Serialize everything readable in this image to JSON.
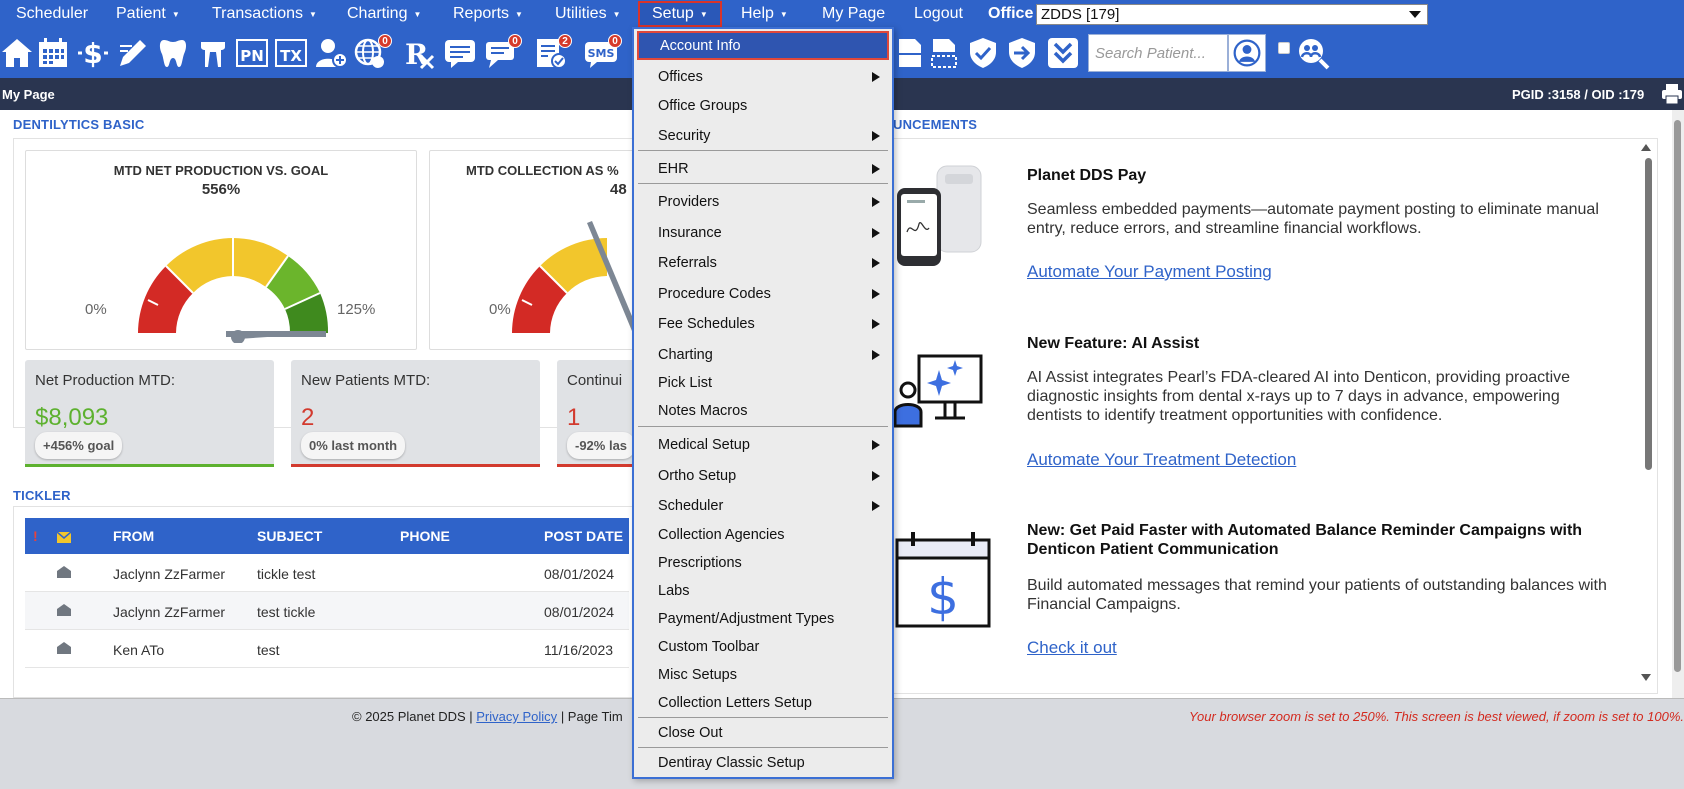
{
  "menubar": {
    "items": [
      "Scheduler",
      "Patient",
      "Transactions",
      "Charting",
      "Reports",
      "Utilities",
      "Setup",
      "Help",
      "My Page",
      "Logout"
    ],
    "office_label": "Office",
    "office_value": "ZDDS [179]"
  },
  "toolbar": {
    "icons": [
      "home-icon",
      "calendar-icon",
      "dollar-icon",
      "pencil-icon",
      "tooth-icon",
      "tooth-roots-icon",
      "pn-icon",
      "tx-icon",
      "add-user-icon",
      "globe-icon",
      "rx-icon",
      "message-icon",
      "chat-icon",
      "checklist-icon",
      "sms-icon",
      "document-icon",
      "dashed-document-icon",
      "shield-check-icon",
      "shield-arrow-icon",
      "double-chevron-down-icon",
      "user-search-icon",
      "group-search-icon"
    ],
    "labels": {
      "pn": "PN",
      "tx": "TX"
    },
    "badges": {
      "globe": "0",
      "chat": "0",
      "checklist": "2",
      "sms": "0"
    },
    "sms_label": "SMS",
    "search_placeholder": "Search Patient..."
  },
  "pagebar": {
    "title": "My Page",
    "ids": "PGID :3158 / OID :179"
  },
  "dentilytics": {
    "title": "DENTILYTICS BASIC",
    "gauge1": {
      "title": "MTD NET PRODUCTION VS. GOAL",
      "pct": "556%",
      "min": "0%",
      "max": "125%"
    },
    "gauge2": {
      "title": "MTD COLLECTION AS %",
      "pct": "48",
      "min": "0%"
    },
    "kpis": [
      {
        "title": "Net Production MTD:",
        "value": "$8,093",
        "chip": "+456% goal",
        "color": "#5db12f"
      },
      {
        "title": "New Patients MTD:",
        "value": "2",
        "chip": "0% last month",
        "color": "#d23a2e"
      },
      {
        "title": "Continui",
        "value": "1",
        "chip": "-92% las",
        "color": "#d23a2e"
      }
    ]
  },
  "tickler": {
    "title": "TICKLER",
    "header": {
      "alert": "!",
      "from": "FROM",
      "subject": "SUBJECT",
      "phone": "PHONE",
      "post_date": "POST DATE"
    },
    "rows": [
      {
        "from": "Jaclynn ZzFarmer",
        "subject": "tickle test",
        "phone": "",
        "post_date": "08/01/2024"
      },
      {
        "from": "Jaclynn ZzFarmer",
        "subject": "test tickle",
        "phone": "",
        "post_date": "08/01/2024"
      },
      {
        "from": "Ken ATo",
        "subject": "test",
        "phone": "",
        "post_date": "11/16/2023"
      }
    ]
  },
  "announcements": {
    "title": "UNCEMENTS",
    "items": [
      {
        "title": "Planet DDS Pay",
        "text": "Seamless embedded payments—automate payment posting to eliminate manual entry, reduce errors, and streamline financial workflows.",
        "link": "Automate Your Payment Posting"
      },
      {
        "title": "New Feature: AI Assist",
        "text": "AI Assist integrates Pearl’s FDA-cleared AI into Denticon, providing proactive diagnostic insights from dental x-rays up to 7 days in advance, empowering dentists to identify treatment opportunities with confidence.",
        "link": "Automate Your Treatment Detection"
      },
      {
        "title": "New: Get Paid Faster with Automated Balance Reminder Campaigns with Denticon Patient Communication",
        "text": "Build automated messages that remind your patients of outstanding balances with Financial Campaigns.",
        "link": "Check it out"
      }
    ]
  },
  "footer": {
    "copyright": "© 2025 Planet DDS |",
    "privacy": "Privacy Policy",
    "page_time": "| Page Tim",
    "zoom_warning": "Your browser zoom is set to 250%. This screen is best viewed, if zoom is set to 100%."
  },
  "setup_menu": {
    "items": [
      {
        "label": "Account Info",
        "sub": false
      },
      {
        "label": "Offices",
        "sub": true
      },
      {
        "label": "Office Groups",
        "sub": false
      },
      {
        "label": "Security",
        "sub": true
      },
      {
        "label": "EHR",
        "sub": true
      },
      {
        "label": "Providers",
        "sub": true
      },
      {
        "label": "Insurance",
        "sub": true
      },
      {
        "label": "Referrals",
        "sub": true
      },
      {
        "label": "Procedure Codes",
        "sub": true
      },
      {
        "label": "Fee Schedules",
        "sub": true
      },
      {
        "label": "Charting",
        "sub": true
      },
      {
        "label": "Pick List",
        "sub": false
      },
      {
        "label": "Notes Macros",
        "sub": false
      },
      {
        "label": "Medical Setup",
        "sub": true
      },
      {
        "label": "Ortho Setup",
        "sub": true
      },
      {
        "label": "Scheduler",
        "sub": true
      },
      {
        "label": "Collection Agencies",
        "sub": false
      },
      {
        "label": "Prescriptions",
        "sub": false
      },
      {
        "label": "Labs",
        "sub": false
      },
      {
        "label": "Payment/Adjustment Types",
        "sub": false
      },
      {
        "label": "Custom Toolbar",
        "sub": false
      },
      {
        "label": "Misc Setups",
        "sub": false
      },
      {
        "label": "Collection Letters Setup",
        "sub": false
      },
      {
        "label": "Close Out",
        "sub": false
      },
      {
        "label": "Dentiray Classic Setup",
        "sub": false
      }
    ]
  }
}
